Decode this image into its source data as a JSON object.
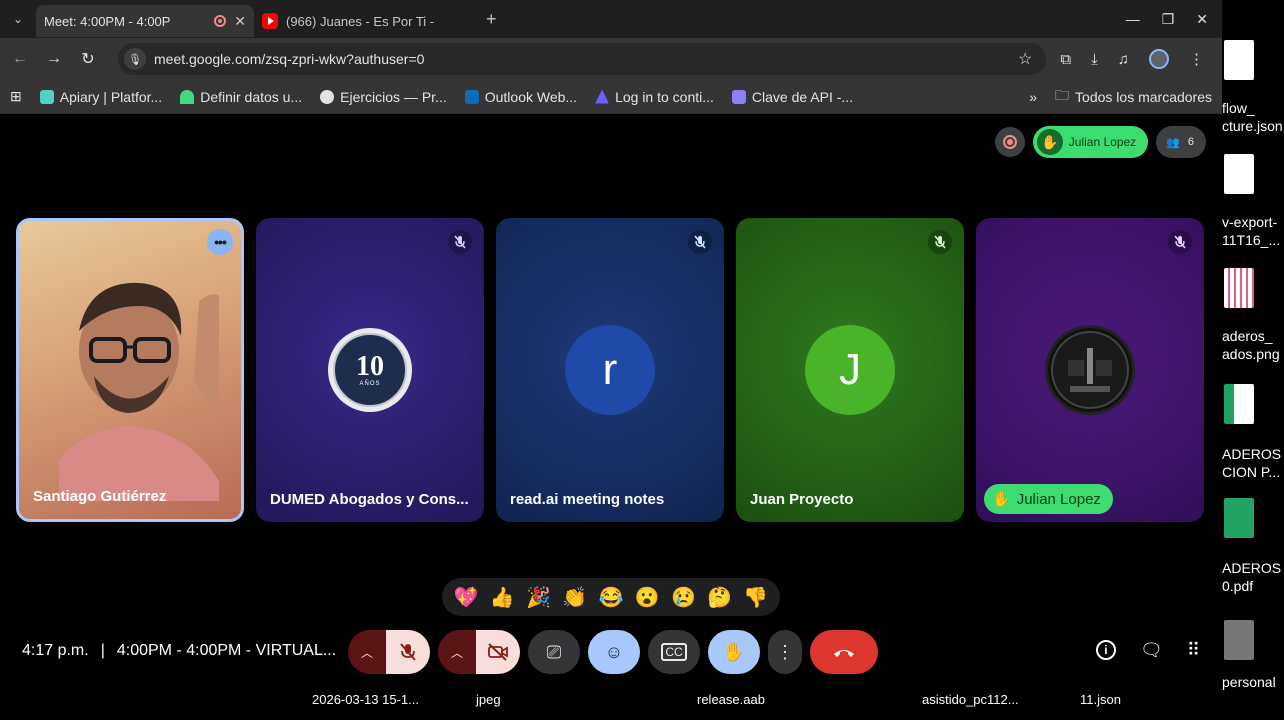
{
  "browser": {
    "tabs": [
      {
        "title": "Meet: 4:00PM - 4:00P",
        "icon": "google-meet-icon",
        "recording": true,
        "active": true
      },
      {
        "title": "(966) Juanes - Es Por Ti -",
        "icon": "youtube-icon",
        "active": false
      }
    ],
    "url": "meet.google.com/zsq-zpri-wkw?authuser=0",
    "bookmarks": [
      {
        "label": "Apiary | Platfor...",
        "color": "#4fd1c5"
      },
      {
        "label": "Definir datos u...",
        "color": "#3ddc84"
      },
      {
        "label": "Ejercicios — Pr...",
        "color": "#e3e3e3"
      },
      {
        "label": "Outlook Web...",
        "color": "#0f6cbd"
      },
      {
        "label": "Log in to conti...",
        "color": "#6d5dfc"
      },
      {
        "label": "Clave de API -...",
        "color": "#8b80f9"
      }
    ],
    "bookmarks_more": "»",
    "all_bookmarks": "Todos los marcadores"
  },
  "meet": {
    "raised_hand_chip": "Julian Lopez",
    "participant_count": "6",
    "participants": [
      {
        "name": "Santiago Gutiérrez",
        "type": "video",
        "muted": false
      },
      {
        "name": "DUMED Abogados y Cons...",
        "type": "logo",
        "logo_number": "10",
        "logo_text": "AÑOS",
        "muted": true
      },
      {
        "name": "read.ai meeting notes",
        "type": "initial",
        "initial": "r",
        "muted": true
      },
      {
        "name": "Juan Proyecto",
        "type": "initial",
        "initial": "J",
        "muted": true
      },
      {
        "name": "Julian Lopez",
        "type": "image",
        "hand_raised": true,
        "muted": true
      }
    ],
    "reactions": [
      "💖",
      "👍",
      "🎉",
      "👏",
      "😂",
      "😮",
      "😢",
      "🤔",
      "👎"
    ],
    "time": "4:17 p.m.",
    "separator": "|",
    "meeting_title": "4:00PM - 4:00PM - VIRTUAL..."
  },
  "desktop": {
    "bottom_files": [
      "2026-03-13 15-1...",
      "jpeg",
      "release.aab",
      "asistido_pc112...",
      "11.json"
    ],
    "side_labels": [
      "flow_",
      "cture.json",
      "v-export-",
      "11T16_...",
      "aderos_",
      "ados.png",
      "ADEROS",
      "CION P...",
      "ADEROS",
      "0.pdf",
      "personal"
    ]
  }
}
